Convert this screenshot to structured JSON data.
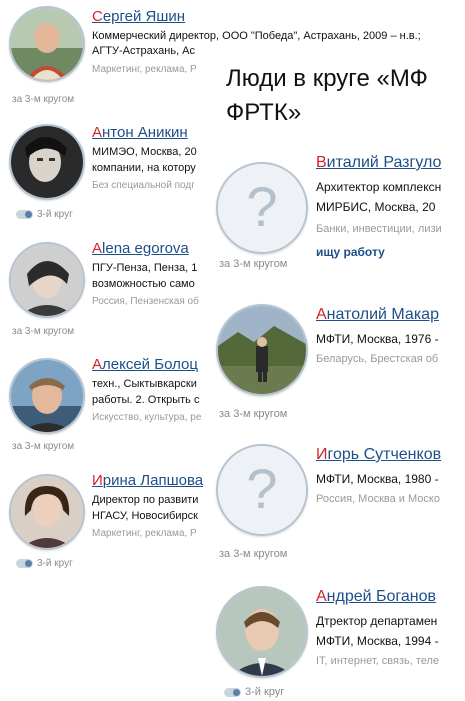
{
  "left_list": [
    {
      "first": "С",
      "rest": "ергей Яшин",
      "line1": "Коммерческий директор, ООО \"Победа\", Астрахань, 2009 – н.в.;",
      "line2": "АГТУ-Астрахань, Ас",
      "meta": "Маркетинг, реклама, Р",
      "circle": "за 3-м кругом"
    },
    {
      "first": "А",
      "rest": "нтон Аникин",
      "line1": "МИМЭО, Москва, 20",
      "line2": "компании, на котору",
      "meta": "Без специальной подг",
      "circle": "3-й круг"
    },
    {
      "first": "A",
      "rest": "lena egorova",
      "line1": "ПГУ-Пенза, Пенза, 1",
      "line2": "возможностью само",
      "meta": "Россия, Пензенская об",
      "circle": "за 3-м кругом"
    },
    {
      "first": "А",
      "rest": "лексей Болоц",
      "line1": "техн., Сыктывкарски",
      "line2": "работы. 2. Открыть с",
      "meta": "Искусство, культура, ре",
      "circle": "за 3-м кругом"
    },
    {
      "first": "И",
      "rest": "рина Лапшова",
      "line1": "Директор по развити",
      "line2": "НГАСУ, Новосибирск",
      "meta": "Маркетинг, реклама, Р",
      "circle": "3-й круг"
    }
  ],
  "overlay": {
    "heading": "Люди в круге «МФ ФРТК»",
    "people": [
      {
        "first": "В",
        "rest": "италий Разгуло",
        "line1": "Архитектор комплексн",
        "line2": "МИРБИС, Москва, 20",
        "meta": "Банки, инвестиции, лизи",
        "extra": "ищу работу",
        "circle": "за 3-м кругом"
      },
      {
        "first": "А",
        "rest": "натолий Макар",
        "line1": "МФТИ, Москва, 1976 -",
        "line2": "",
        "meta": "Беларусь, Брестская об",
        "circle": "за 3-м кругом"
      },
      {
        "first": "И",
        "rest": "горь Сутченков",
        "line1": "МФТИ, Москва, 1980 -",
        "line2": "",
        "meta": "Россия, Москва и Моско",
        "circle": "за 3-м кругом"
      },
      {
        "first": "А",
        "rest": "ндрей Боганов",
        "line1": "Дтректор департамен",
        "line2": "МФТИ, Москва, 1994 -",
        "meta": "IT, интернет, связь, теле",
        "circle": "3-й круг"
      }
    ]
  }
}
